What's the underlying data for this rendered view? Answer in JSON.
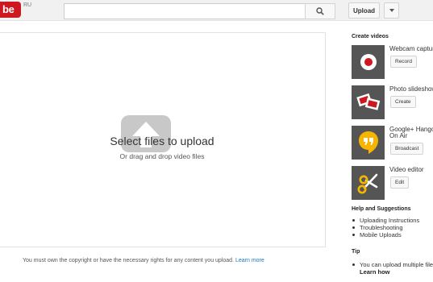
{
  "header": {
    "logo_text": "be",
    "region_label": "RU",
    "search_placeholder": "",
    "search_icon": "search-icon",
    "upload_label": "Upload",
    "upload_menu_icon": "caret-down-icon"
  },
  "upload_area": {
    "icon": "upload-arrow-icon",
    "title": "Select files to upload",
    "subtitle": "Or drag and drop video files"
  },
  "footer": {
    "copyright_text": "You must own the copyright or have the necessary rights for any content you upload.",
    "learn_more": "Learn more"
  },
  "sidebar": {
    "create_videos_title": "Create videos",
    "tools": [
      {
        "label": "Webcam capture",
        "button": "Record",
        "icon": "record-icon"
      },
      {
        "label": "Photo slideshow",
        "button": "Create",
        "icon": "photos-icon"
      },
      {
        "label_line1": "Google+ Hangouts",
        "label_line2": "On Air",
        "button": "Broadcast",
        "icon": "hangouts-icon"
      },
      {
        "label": "Video editor",
        "button": "Edit",
        "icon": "scissors-icon"
      }
    ],
    "help_title": "Help and Suggestions",
    "help_links": [
      "Uploading Instructions",
      "Troubleshooting",
      "Mobile Uploads"
    ],
    "tip_title": "Tip",
    "tip_text": "You can upload multiple files at once.",
    "tip_link": "Learn how"
  },
  "colors": {
    "brand_red": "#cc181e",
    "link_blue": "#167ac6",
    "hangouts_yellow": "#f7b500"
  }
}
